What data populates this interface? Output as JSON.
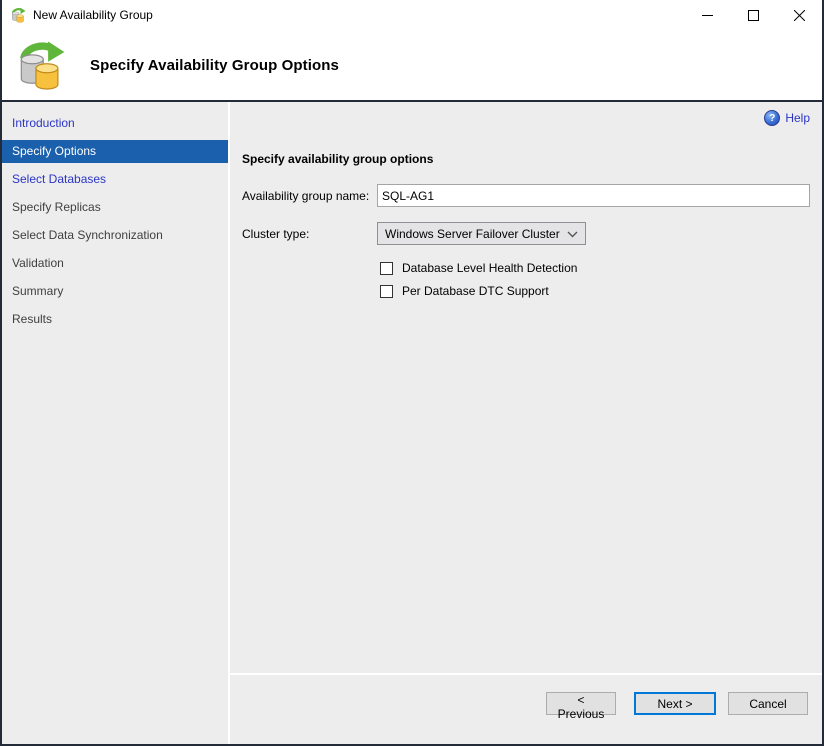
{
  "window": {
    "title": "New Availability Group"
  },
  "header": {
    "title": "Specify Availability Group Options"
  },
  "sidebar": {
    "items": [
      {
        "label": "Introduction",
        "state": "visited"
      },
      {
        "label": "Specify Options",
        "state": "selected"
      },
      {
        "label": "Select Databases",
        "state": "visited"
      },
      {
        "label": "Specify Replicas",
        "state": "upcoming"
      },
      {
        "label": "Select Data Synchronization",
        "state": "upcoming"
      },
      {
        "label": "Validation",
        "state": "upcoming"
      },
      {
        "label": "Summary",
        "state": "upcoming"
      },
      {
        "label": "Results",
        "state": "upcoming"
      }
    ]
  },
  "main": {
    "help_label": "Help",
    "help_glyph": "?",
    "section_title": "Specify availability group options",
    "name_field": {
      "label": "Availability group name:",
      "value": "SQL-AG1"
    },
    "cluster_field": {
      "label": "Cluster type:",
      "value": "Windows Server Failover Cluster"
    },
    "checkboxes": [
      {
        "label": "Database Level Health Detection",
        "checked": false
      },
      {
        "label": "Per Database DTC Support",
        "checked": false
      }
    ]
  },
  "footer": {
    "previous": "< Previous",
    "next": "Next >",
    "cancel": "Cancel"
  },
  "colors": {
    "selected_step_bg": "#1a60ac",
    "link_blue": "#2b35c4",
    "next_button_border": "#0078d7",
    "window_border": "#242b38",
    "body_bg": "#ededee"
  }
}
